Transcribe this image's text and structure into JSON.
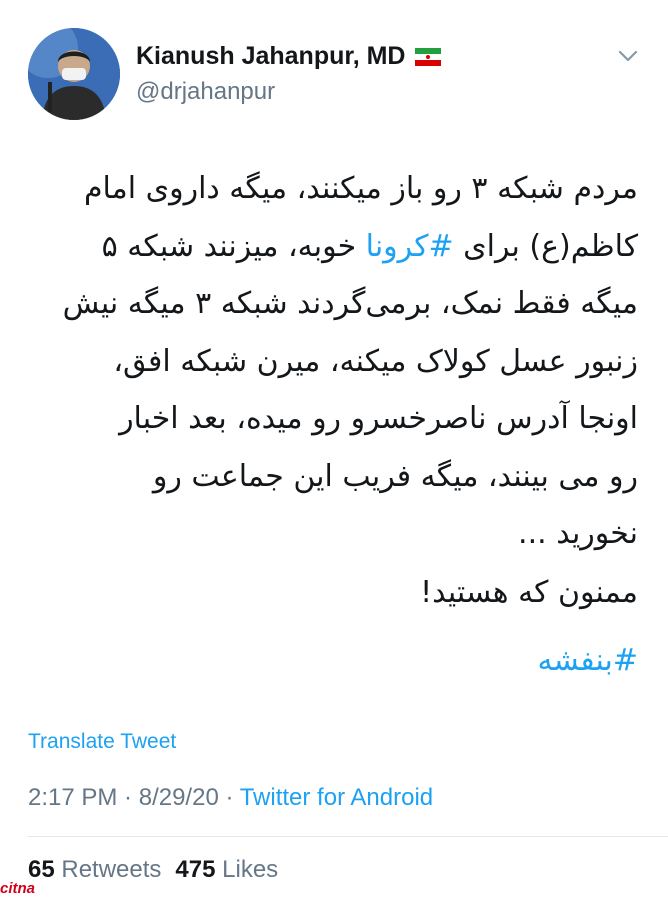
{
  "author": {
    "display_name": "Kianush Jahanpur, MD",
    "handle": "@drjahanpur",
    "avatar_icon": "profile-photo",
    "flag_icon": "iran-flag-icon"
  },
  "tweet": {
    "lines": [
      {
        "before": "مردم شبکه ۳ رو باز میکنند، میگه داروی امام",
        "tag": "",
        "after": ""
      },
      {
        "before": "کاظم(ع) برای ",
        "tag": "#کرونا",
        "after": " خوبه، میزنند شبکه ۵"
      },
      {
        "before": "میگه فقط نمک، برمی‌گردند شبکه ۳ میگه نیش",
        "tag": "",
        "after": ""
      },
      {
        "before": "زنبور عسل کولاک میکنه، میرن شبکه افق،",
        "tag": "",
        "after": ""
      },
      {
        "before": "اونجا آدرس ناصرخسرو رو میده، بعد اخبار",
        "tag": "",
        "after": ""
      },
      {
        "before": "رو می بینند، میگه فریب این جماعت رو",
        "tag": "",
        "after": ""
      },
      {
        "before": "نخورید ...",
        "tag": "",
        "after": ""
      }
    ],
    "thanks": "ممنون که هستید!",
    "closing_hashtag": "#بنفشه"
  },
  "actions": {
    "translate_label": "Translate Tweet"
  },
  "meta": {
    "time": "2:17 PM",
    "date": "8/29/20",
    "separator": " · ",
    "source": "Twitter for Android"
  },
  "stats": {
    "retweets_count": "65",
    "retweets_label": "Retweets",
    "likes_count": "475",
    "likes_label": "Likes"
  },
  "watermark": "citna",
  "colors": {
    "link": "#1da1f2",
    "secondary_text": "#657786",
    "primary_text": "#14171a"
  }
}
